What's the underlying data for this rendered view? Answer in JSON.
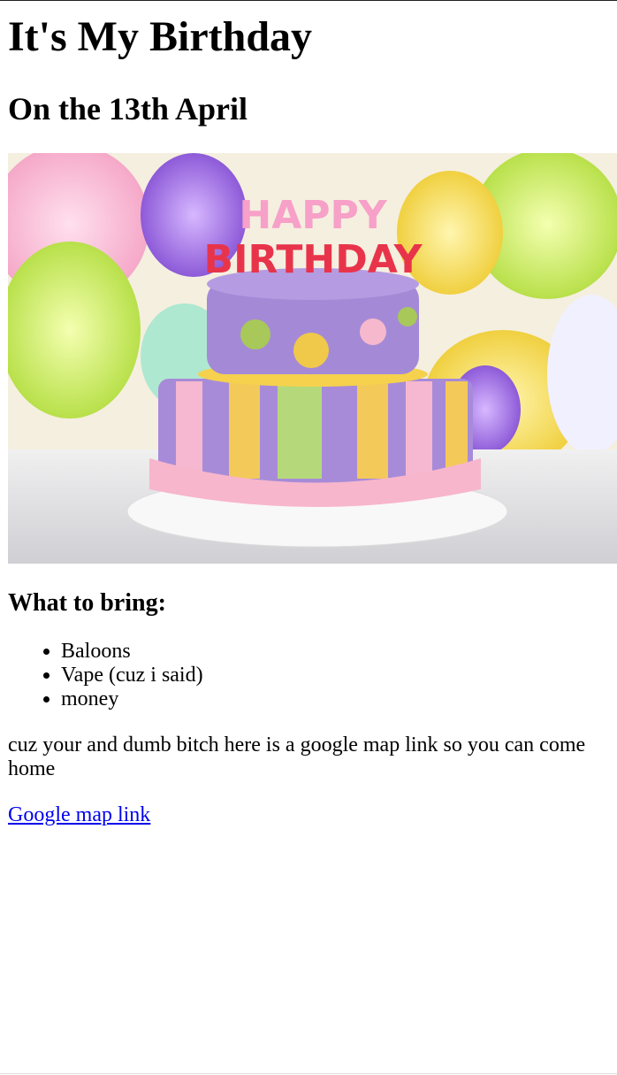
{
  "page": {
    "title": "It's My Birthday",
    "subtitle": "On the 13th April",
    "image": {
      "alt": "Birthday cake",
      "caption_on_cake": "HAPPY BIRTHDAY"
    },
    "bring_heading": "What to bring:",
    "bring_items": [
      "Baloons",
      "Vape (cuz i said)",
      "money"
    ],
    "paragraph": "cuz your and dumb bitch here is a google map link so you can come home",
    "link_label": "Google map link",
    "link_color": "#0000ee"
  }
}
